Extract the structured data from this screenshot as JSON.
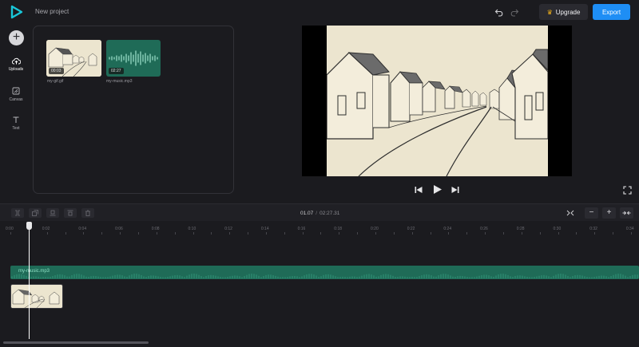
{
  "app": {
    "project_name": "New project"
  },
  "header": {
    "upgrade_label": "Upgrade",
    "export_label": "Export"
  },
  "colors": {
    "accent": "#1e8ef5",
    "audio_track": "#1f6b57",
    "crown": "#f2b21b",
    "background": "#1b1b1f"
  },
  "sidebar": {
    "items": [
      {
        "label": "Uploads",
        "icon": "cloud-upload-icon"
      },
      {
        "label": "Canvas",
        "icon": "canvas-icon"
      },
      {
        "label": "Text",
        "icon": "text-icon"
      }
    ]
  },
  "media": {
    "items": [
      {
        "name": "my-gif.gif",
        "duration": "00:03"
      },
      {
        "name": "my-music.mp3",
        "duration": "02:27"
      }
    ]
  },
  "timeline": {
    "current_time": "01.07",
    "separator": "/",
    "total_time": "02:27.31",
    "audio_clip_label": "my-music.mp3",
    "ruler_ticks": [
      "0:00",
      "0:02",
      "0:04",
      "0:06",
      "0:08",
      "0:10",
      "0:12",
      "0:14",
      "0:16",
      "0:18",
      "0:20",
      "0:22",
      "0:24",
      "0:26",
      "0:28",
      "0:30",
      "0:32",
      "0:34"
    ]
  }
}
